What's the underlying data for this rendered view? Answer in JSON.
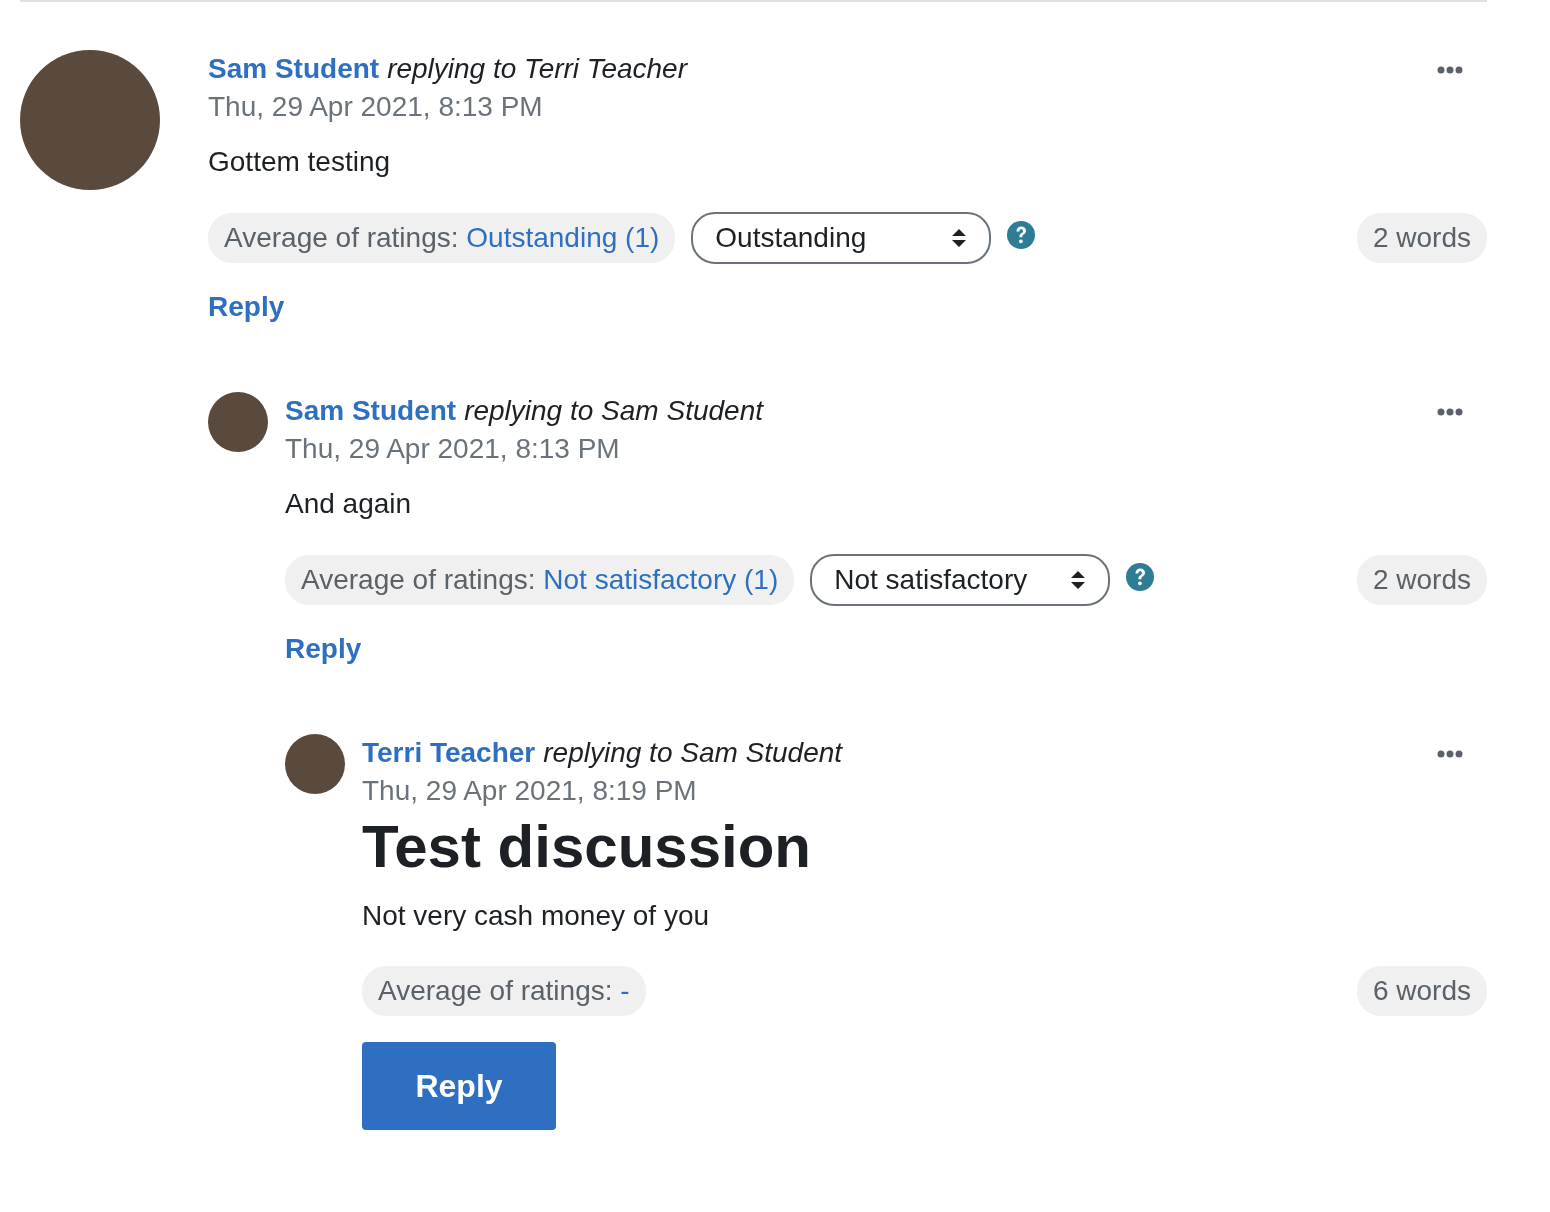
{
  "posts": [
    {
      "author": "Sam Student",
      "replying": "replying to Terri Teacher",
      "date": "Thu, 29 Apr 2021, 8:13 PM",
      "body": "Gottem testing",
      "rating_label": "Average of ratings:",
      "rating_value": "Outstanding (1)",
      "rating_select": "Outstanding",
      "word_count": "2 words",
      "reply": {
        "label": "Reply",
        "kind": "link"
      },
      "children": [
        {
          "author": "Sam Student",
          "replying": "replying to Sam Student",
          "date": "Thu, 29 Apr 2021, 8:13 PM",
          "body": "And again",
          "rating_label": "Average of ratings:",
          "rating_value": "Not satisfactory (1)",
          "rating_select": "Not satisfactory",
          "word_count": "2 words",
          "reply": {
            "label": "Reply",
            "kind": "link"
          },
          "children": [
            {
              "author": "Terri Teacher",
              "replying": "replying to Sam Student",
              "date": "Thu, 29 Apr 2021, 8:19 PM",
              "title": "Test discussion",
              "body": "Not very cash money of you",
              "rating_label": "Average of ratings:",
              "rating_value": "-",
              "word_count": "6 words",
              "reply": {
                "label": "Reply",
                "kind": "button"
              }
            }
          ]
        }
      ]
    }
  ]
}
